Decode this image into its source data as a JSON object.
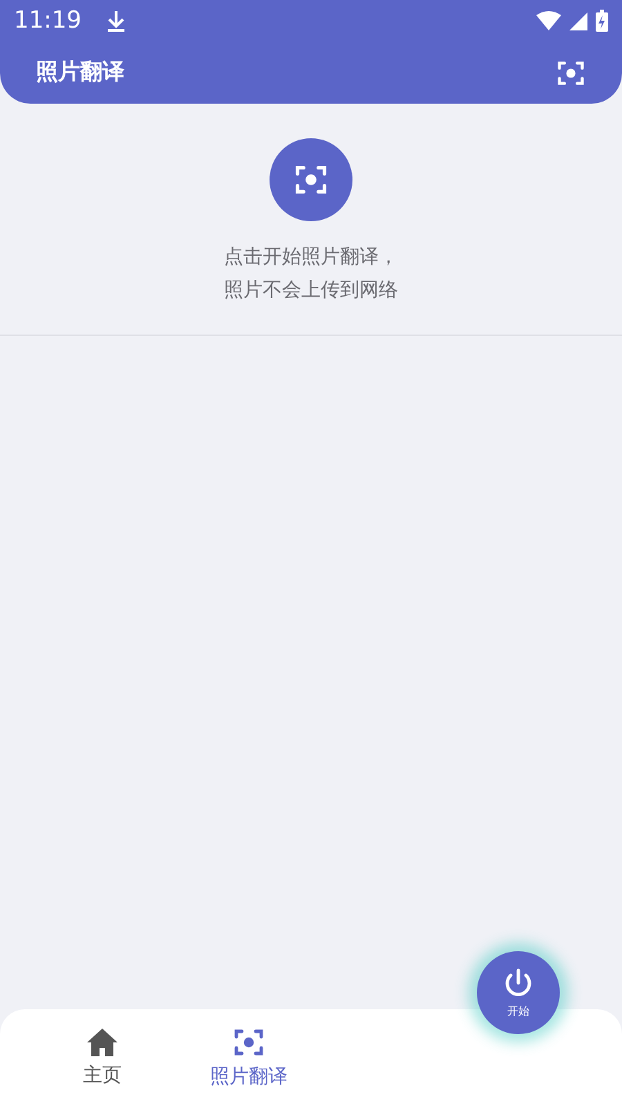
{
  "status_bar": {
    "time": "11:19"
  },
  "header": {
    "title": "照片翻译"
  },
  "intro": {
    "lines": [
      "点击开始照片翻译，",
      "照片不会上传到网络"
    ]
  },
  "fab": {
    "label": "开始"
  },
  "bottom_nav": [
    {
      "label": "主页",
      "kind": "home",
      "selected": false
    },
    {
      "label": "照片翻译",
      "kind": "scan",
      "selected": true
    }
  ]
}
